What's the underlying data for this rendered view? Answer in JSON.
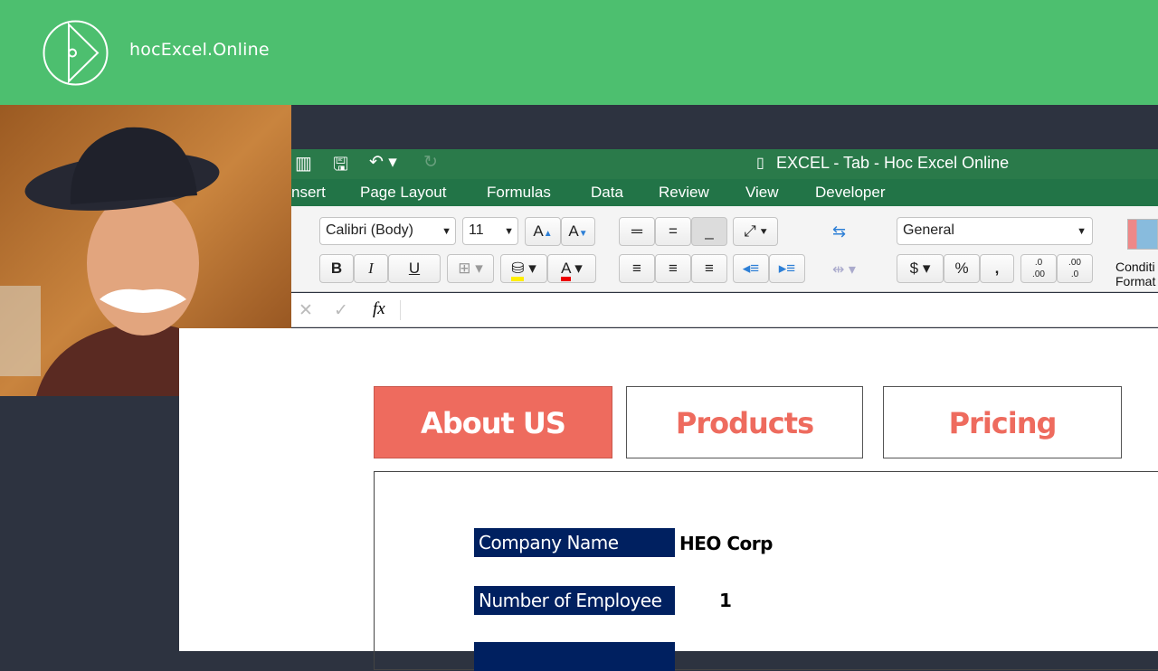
{
  "brand": {
    "name": "hocExcel.Online"
  },
  "excel": {
    "title": "EXCEL - Tab - Hoc Excel Online",
    "tabs": [
      "nsert",
      "Page Layout",
      "Formulas",
      "Data",
      "Review",
      "View",
      "Developer"
    ],
    "font_name": "Calibri (Body)",
    "font_size": "11",
    "number_format": "General",
    "bold": "B",
    "italic": "I",
    "underline": "U",
    "font_color": "A",
    "grow": "A",
    "shrink": "A",
    "currency": "$",
    "percent": "%",
    "comma": ",",
    "fx": "fx",
    "cancel": "✕",
    "enter": "✓",
    "inc_decimal": ".0\n.00",
    "dec_decimal": ".00\n.0",
    "conditional": "Conditi",
    "conditional2": "Format"
  },
  "sheet": {
    "nav": {
      "about": "About US",
      "products": "Products",
      "pricing": "Pricing"
    },
    "rows": [
      {
        "label": "Company Name",
        "value": "HEO Corp"
      },
      {
        "label": "Number of Employee",
        "value": "1"
      }
    ]
  },
  "colors": {
    "accent": "#ee6b5e",
    "navy": "#002060",
    "green": "#4dbf6f"
  }
}
